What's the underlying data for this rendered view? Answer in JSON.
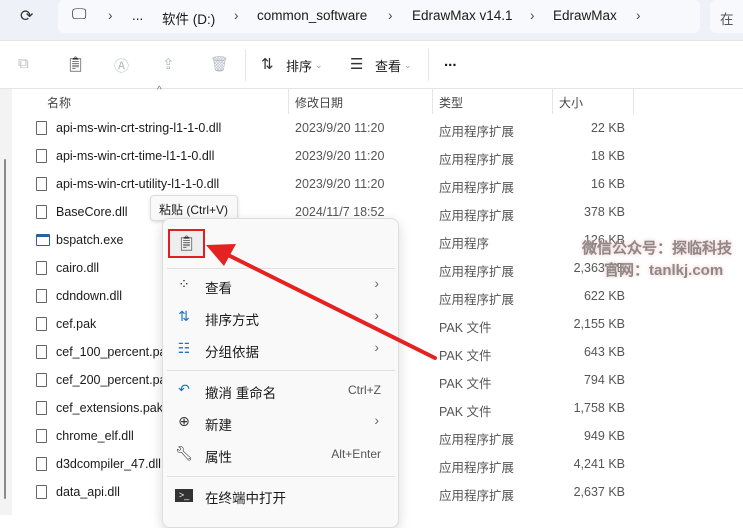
{
  "address": {
    "crumbs": [
      "...",
      "软件 (D:)",
      "common_software",
      "EdrawMax v14.1",
      "EdrawMax"
    ],
    "search_prefix": "在"
  },
  "toolbar": {
    "sort": "排序",
    "view": "查看",
    "more": "..."
  },
  "columns": {
    "name": "名称",
    "date": "修改日期",
    "type": "类型",
    "size": "大小"
  },
  "files": [
    {
      "name": "api-ms-win-crt-string-l1-1-0.dll",
      "date": "2023/9/20 11:20",
      "type": "应用程序扩展",
      "size": "22 KB"
    },
    {
      "name": "api-ms-win-crt-time-l1-1-0.dll",
      "date": "2023/9/20 11:20",
      "type": "应用程序扩展",
      "size": "18 KB"
    },
    {
      "name": "api-ms-win-crt-utility-l1-1-0.dll",
      "date": "2023/9/20 11:20",
      "type": "应用程序扩展",
      "size": "16 KB"
    },
    {
      "name": "BaseCore.dll",
      "date": "2024/11/7 18:52",
      "type": "应用程序扩展",
      "size": "378 KB"
    },
    {
      "name": "bspatch.exe",
      "date": "",
      "type": "应用程序",
      "size": "126 KB"
    },
    {
      "name": "cairo.dll",
      "date": "",
      "type": "应用程序扩展",
      "size": "2,363 KB"
    },
    {
      "name": "cdndown.dll",
      "date": "",
      "type": "应用程序扩展",
      "size": "622 KB"
    },
    {
      "name": "cef.pak",
      "date": "",
      "type": "PAK 文件",
      "size": "2,155 KB"
    },
    {
      "name": "cef_100_percent.pak",
      "date": "",
      "type": "PAK 文件",
      "size": "643 KB"
    },
    {
      "name": "cef_200_percent.pak",
      "date": "",
      "type": "PAK 文件",
      "size": "794 KB"
    },
    {
      "name": "cef_extensions.pak",
      "date": "",
      "type": "PAK 文件",
      "size": "1,758 KB"
    },
    {
      "name": "chrome_elf.dll",
      "date": "",
      "type": "应用程序扩展",
      "size": "949 KB"
    },
    {
      "name": "d3dcompiler_47.dll",
      "date": "",
      "type": "应用程序扩展",
      "size": "4,241 KB"
    },
    {
      "name": "data_api.dll",
      "date": "",
      "type": "应用程序扩展",
      "size": "2,637 KB"
    }
  ],
  "tooltip": "粘贴 (Ctrl+V)",
  "menu": {
    "view": "查看",
    "sort": "排序方式",
    "group": "分组依据",
    "undo": "撤消 重命名",
    "undo_shortcut": "Ctrl+Z",
    "new": "新建",
    "properties": "属性",
    "properties_shortcut": "Alt+Enter",
    "terminal": "在终端中打开"
  },
  "watermark": {
    "line1": "微信公众号：探临科技",
    "line2": "官网：tanlkj.com"
  },
  "colors": {
    "highlight": "#e02020",
    "accent": "#1a73c8"
  }
}
